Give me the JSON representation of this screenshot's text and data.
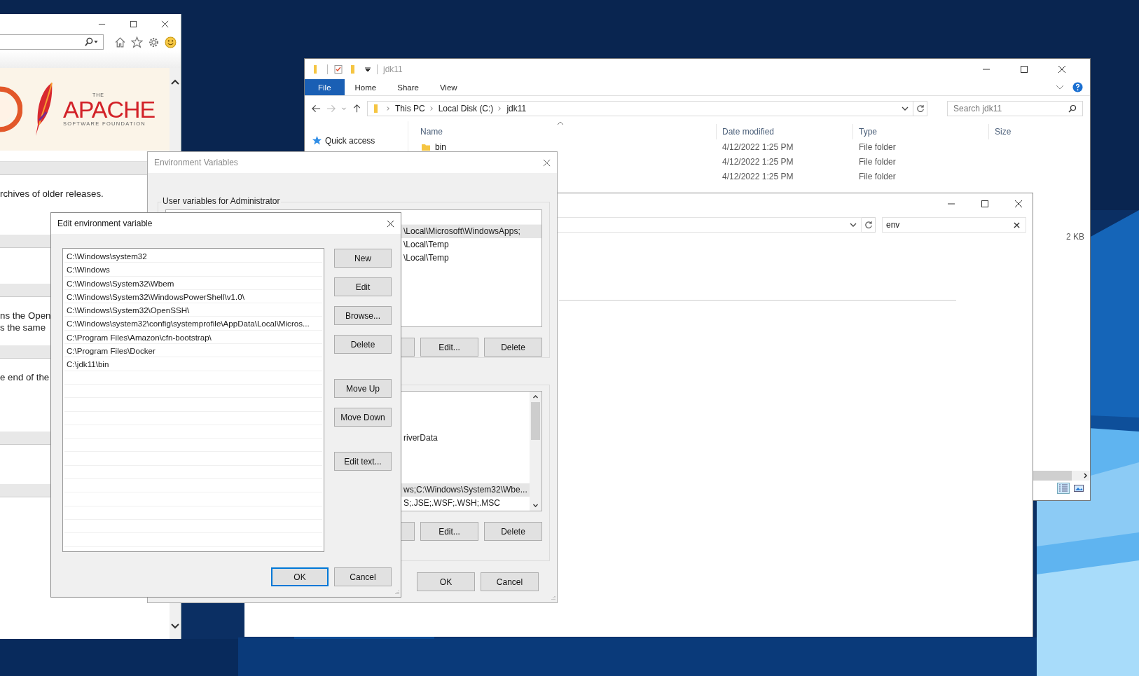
{
  "browser": {
    "logo": {
      "small": "THE",
      "name": "APACHE",
      "tagline": "SOFTWARE FOUNDATION"
    },
    "text_blocks": [
      {
        "lines": [
          "rchives of older releases."
        ]
      },
      {
        "lines": [
          "ns the Open",
          "s the same"
        ]
      },
      {
        "lines": [
          "e end of the"
        ]
      }
    ]
  },
  "explorer": {
    "title": "jdk11",
    "ribbon_tabs": [
      {
        "label": "File",
        "selected": true
      },
      {
        "label": "Home",
        "selected": false
      },
      {
        "label": "Share",
        "selected": false
      },
      {
        "label": "View",
        "selected": false
      }
    ],
    "breadcrumb": [
      "This PC",
      "Local Disk (C:)",
      "jdk11"
    ],
    "search": {
      "placeholder": "Search jdk11"
    },
    "nav": [
      "Quick access"
    ],
    "columns": [
      "Name",
      "Date modified",
      "Type",
      "Size"
    ],
    "rows": [
      {
        "name": "bin",
        "date": "4/12/2022 1:25 PM",
        "type": "File folder"
      },
      {
        "date": "4/12/2022 1:25 PM",
        "type": "File folder"
      },
      {
        "date": "4/12/2022 1:25 PM",
        "type": "File folder"
      }
    ],
    "partial_row": {
      "size": "2 KB"
    }
  },
  "search_window": {
    "search": {
      "value": "env"
    }
  },
  "env_dialog": {
    "title": "Environment Variables",
    "user_group": "User variables for Administrator",
    "user_items": [
      {
        "text": "\\Local\\Microsoft\\WindowsApps;",
        "selected": true
      },
      {
        "text": "\\Local\\Temp",
        "selected": false
      },
      {
        "text": "\\Local\\Temp",
        "selected": false
      }
    ],
    "user_buttons": [
      "Edit...",
      "Delete"
    ],
    "system_items": [
      {
        "text": "riverData",
        "selected": false
      },
      {
        "text": "ws;C:\\Windows\\System32\\Wbe...",
        "selected": true
      },
      {
        "text": "S;.JSE;.WSF;.WSH;.MSC",
        "selected": false
      }
    ],
    "system_buttons": [
      "Edit...",
      "Delete"
    ],
    "footer": [
      {
        "label": "OK",
        "default": false
      },
      {
        "label": "Cancel",
        "default": false
      }
    ]
  },
  "edit_dialog": {
    "title": "Edit environment variable",
    "items": [
      {
        "text": "C:\\Windows\\system32",
        "selected": false
      },
      {
        "text": "C:\\Windows",
        "selected": false
      },
      {
        "text": "C:\\Windows\\System32\\Wbem",
        "selected": false
      },
      {
        "text": "C:\\Windows\\System32\\WindowsPowerShell\\v1.0\\",
        "selected": false
      },
      {
        "text": "C:\\Windows\\System32\\OpenSSH\\",
        "selected": false
      },
      {
        "text": "C:\\Windows\\system32\\config\\systemprofile\\AppData\\Local\\Micros...",
        "selected": false
      },
      {
        "text": "C:\\Program Files\\Amazon\\cfn-bootstrap\\",
        "selected": false
      },
      {
        "text": "C:\\Program Files\\Docker",
        "selected": false
      },
      {
        "text": "C:\\jdk11\\bin",
        "selected": false
      }
    ],
    "buttons": [
      "New",
      "Edit",
      "Browse...",
      "Delete",
      "Move Up",
      "Move Down",
      "Edit text..."
    ],
    "footer": [
      {
        "label": "OK",
        "default": true
      },
      {
        "label": "Cancel",
        "default": false
      }
    ]
  }
}
